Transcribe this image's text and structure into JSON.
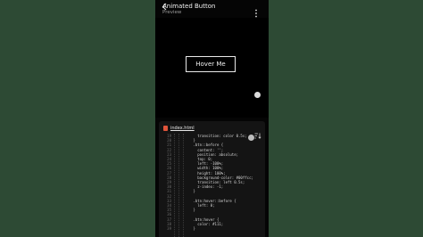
{
  "app": {
    "title": "Animated Button",
    "subtitle": "Preview",
    "back_icon": "back-arrow-icon",
    "menu_icon": "more-vert-icon"
  },
  "preview": {
    "button_label": "Hover Me"
  },
  "editor": {
    "file_name": "index.html",
    "file_icon": "html-file-icon",
    "format_icon": "sort-icon",
    "code_lines": [
      {
        "n": "19",
        "text": "        transition: color 0.5s;"
      },
      {
        "n": "20",
        "text": "      }"
      },
      {
        "n": "21",
        "text": "      .btn::before {"
      },
      {
        "n": "22",
        "text": "        content: '';"
      },
      {
        "n": "23",
        "text": "        position: absolute;"
      },
      {
        "n": "24",
        "text": "        top: 0;"
      },
      {
        "n": "25",
        "text": "        left: -100%;"
      },
      {
        "n": "26",
        "text": "        width: 100%;"
      },
      {
        "n": "27",
        "text": "        height: 100%;"
      },
      {
        "n": "28",
        "text": "        background-color: #00ffcc;"
      },
      {
        "n": "29",
        "text": "        transition: left 0.5s;"
      },
      {
        "n": "30",
        "text": "        z-index: -1;"
      },
      {
        "n": "31",
        "text": "      }"
      },
      {
        "n": "32",
        "text": ""
      },
      {
        "n": "33",
        "text": "      .btn:hover::before {"
      },
      {
        "n": "34",
        "text": "        left: 0;"
      },
      {
        "n": "35",
        "text": "      }"
      },
      {
        "n": "36",
        "text": ""
      },
      {
        "n": "37",
        "text": "      .btn:hover {"
      },
      {
        "n": "38",
        "text": "        color: #111;"
      },
      {
        "n": "39",
        "text": "      }"
      }
    ]
  }
}
